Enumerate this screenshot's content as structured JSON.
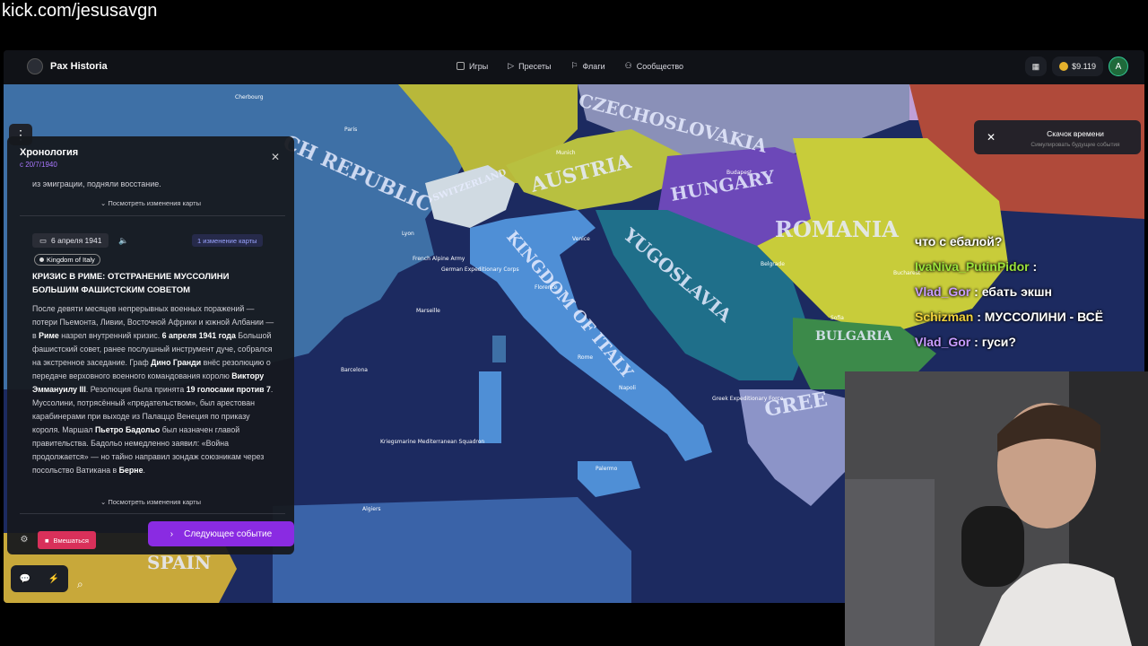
{
  "stream_url": "kick.com/jesusavgn",
  "app": {
    "logo": "Pax Historia",
    "nav": [
      "Игры",
      "Пресеты",
      "Флаги",
      "Сообщество"
    ],
    "balance": "$9.119",
    "avatar_letter": "A"
  },
  "time_skip": {
    "title": "Скачок времени",
    "subtitle": "Симулировать будущие события"
  },
  "timeline": {
    "title": "Хронология",
    "since": "с 20/7/1940",
    "prev_text": "из эмиграции, подняли восстание.",
    "view_map_changes": "Посмотреть изменения карты",
    "event": {
      "date": "6 апреля 1941",
      "changes_badge": "1 изменение карты",
      "country": "Kingdom of Italy",
      "title": "КРИЗИС В РИМЕ: ОТСТРАНЕНИЕ МУССОЛИНИ БОЛЬШИМ ФАШИСТСКИМ СОВЕТОМ"
    },
    "intervene": "Вмешаться",
    "next_event": "Следующее событие"
  },
  "map_labels": {
    "czechoslovakia": "CZECHOSLOVAKIA",
    "austria": "AUSTRIA",
    "hungary": "HUNGARY",
    "romania": "ROMANIA",
    "yugoslavia": "YUGOSLAVIA",
    "bulgaria": "BULGARIA",
    "greece": "GREE",
    "switzerland": "SWITZERLAND",
    "french_republic": "CH REPUBLIC",
    "kingdom_italy": "KINGDOM OF ITALY",
    "spain": "SPAIN",
    "cities": [
      "Paris",
      "Cherbourg",
      "Lyon",
      "Marseille",
      "Barcelona",
      "Algiers",
      "Rome",
      "Napoli",
      "Palermo",
      "Florence",
      "Munich",
      "Budapest",
      "Belgrade",
      "Bucharest",
      "Sofia",
      "Venice"
    ],
    "units": [
      "French Alpine Army",
      "German Expeditionary Corps",
      "Kriegsmarine Mediterranean Squadron",
      "Greek Expeditionary Force"
    ]
  },
  "chat": [
    {
      "user": "",
      "text": "что с ебалой?",
      "color": "#ffffff"
    },
    {
      "user": "IvaNiva_PutinPidor",
      "text": " : ",
      "color": "#9be33a"
    },
    {
      "user": "Vlad_Gor",
      "text": " : ебать экшн",
      "color": "#c89cff"
    },
    {
      "user": "Schizman",
      "text": " : МУССОЛИНИ - ВСЁ",
      "color": "#f0d23c"
    },
    {
      "user": "Vlad_Gor",
      "text": " : гуси?",
      "color": "#c89cff"
    }
  ]
}
